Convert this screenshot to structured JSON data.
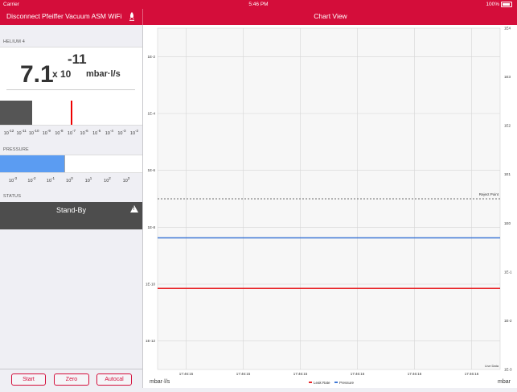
{
  "status_bar": {
    "carrier": "Carrier",
    "time": "5:46 PM",
    "battery": "100%"
  },
  "nav": {
    "disconnect": "Disconnect",
    "device": "Pfeiffer Vacuum ASM WiFi",
    "title": "Chart View",
    "icon": "rocket-icon"
  },
  "left": {
    "helium_label": "HELIUM 4",
    "leak": {
      "mantissa": "7.1",
      "times": "x 10",
      "exponent": "-11",
      "unit": "mbar·l/s",
      "bar_fill_fraction": 0.225,
      "marker_exponent": -7
    },
    "leak_scale": [
      "-12",
      "-11",
      "-10",
      "-9",
      "-8",
      "-7",
      "-6",
      "-5",
      "-4",
      "-3",
      "-2"
    ],
    "pressure_label": "PRESSURE",
    "pressure": {
      "bar_fill_fraction": 0.45
    },
    "pressure_scale": [
      "-3",
      "-2",
      "-1",
      "0",
      "1",
      "2",
      "3"
    ],
    "status_label": "STATUS",
    "status_value": "Stand-By",
    "buttons": {
      "start": "Start",
      "zero": "Zero",
      "autocal": "Autocal"
    }
  },
  "chart_data": {
    "type": "line",
    "left_axis": {
      "unit": "mbar·l/s",
      "ticks": [
        "1E-2",
        "1E-4",
        "1E-6",
        "1E-8",
        "1E-10",
        "1E-12"
      ],
      "range_exp": [
        -13,
        -1
      ],
      "scale": "log"
    },
    "right_axis": {
      "unit": "mbar",
      "ticks": [
        "1E4",
        "1E3",
        "1E2",
        "1E1",
        "1E0",
        "1E-1",
        "1E-2",
        "1E-3"
      ],
      "range_exp": [
        -3,
        4
      ],
      "scale": "log"
    },
    "x_ticks": [
      "17:46:15",
      "17:46:15",
      "17:46:15",
      "17:46:16",
      "17:46:16",
      "17:46:16"
    ],
    "grid": true,
    "reject_point": {
      "label": "Reject Point",
      "value_exp": -7.0
    },
    "series": [
      {
        "name": "Leak Rate",
        "color": "#e8262a",
        "value_exp": -10.15,
        "axis": "left"
      },
      {
        "name": "Pressure",
        "color": "#3f78d6",
        "value_exp": -0.3,
        "axis": "right"
      }
    ],
    "live_data_label": "Live Data"
  },
  "colors": {
    "brand": "#d40d3a",
    "leak": "#555555",
    "pressure": "#5b9cf2",
    "status_bg": "#4d4d4d"
  }
}
